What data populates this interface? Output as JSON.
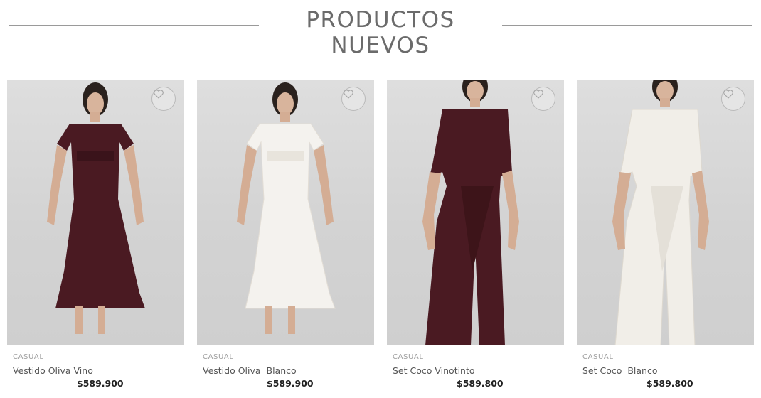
{
  "section": {
    "title": "PRODUCTOS NUEVOS"
  },
  "products": [
    {
      "category": "CASUAL",
      "name": "Vestido Oliva Vino",
      "price": "$589.900",
      "garment_color": "#4a1a22",
      "garment_type": "dress",
      "icon": "heart-icon"
    },
    {
      "category": "CASUAL",
      "name": "Vestido Oliva  Blanco",
      "price": "$589.900",
      "garment_color": "#f4f2ee",
      "garment_type": "dress",
      "icon": "heart-icon"
    },
    {
      "category": "CASUAL",
      "name": "Set Coco Vinotinto",
      "price": "$589.800",
      "garment_color": "#4a1a22",
      "garment_type": "set",
      "icon": "heart-icon"
    },
    {
      "category": "CASUAL",
      "name": "Set Coco  Blanco",
      "price": "$589.800",
      "garment_color": "#f1eee8",
      "garment_type": "set",
      "icon": "heart-icon"
    }
  ]
}
